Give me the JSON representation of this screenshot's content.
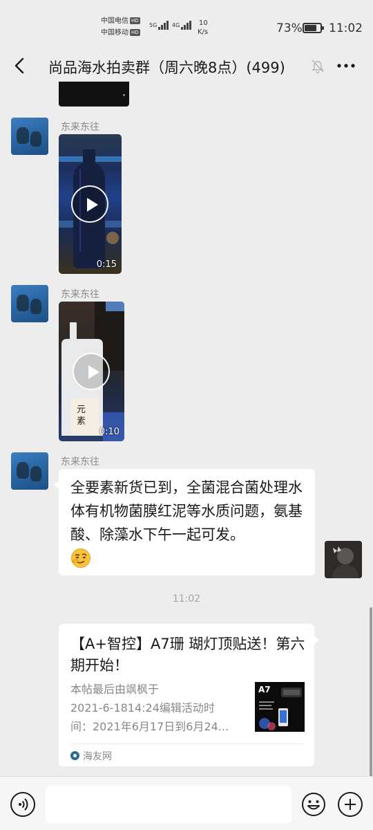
{
  "status_bar": {
    "carrier_1": "中国电信",
    "carrier_2": "中国移动",
    "hd_label": "HD",
    "net_5g": "5G",
    "net_4g": "4G",
    "speed_value": "10",
    "speed_unit": "K/s",
    "battery_percent": "73%",
    "time": "11:02"
  },
  "header": {
    "title": "尚品海水拍卖群（周六晚8点）(499)",
    "back_icon": "chevron-left-icon",
    "mute_icon": "bell-mute-icon",
    "more_icon": "ellipsis-icon"
  },
  "messages": [
    {
      "sender": "东来东往",
      "type": "video",
      "duration": "0:15"
    },
    {
      "sender": "东来东往",
      "type": "video",
      "duration": "0:10",
      "bottle_text": "元素"
    },
    {
      "sender": "东来东往",
      "type": "text",
      "text": "全要素新货已到，全菌混合菌处理水体有机物菌膜红泥等水质问题，氨基酸、除藻水下午一起可发。",
      "emoji": "smirk-emoji"
    }
  ],
  "time_separator": "11:02",
  "link_card": {
    "title": "【A+智控】A7珊 瑚灯顶贴送！第六期开始！",
    "desc_line_1": "本帖最后由飒枫于",
    "desc_line_2": "2021-6-1814:24编辑活动时",
    "desc_line_3": "间：2021年6月17日到6月24...",
    "thumb_label": "A7",
    "source": "海友网"
  },
  "input_bar": {
    "voice_icon": "voice-icon",
    "emoji_icon": "emoji-icon",
    "plus_icon": "plus-icon",
    "placeholder": ""
  },
  "colors": {
    "background": "#ededed",
    "bubble": "#ffffff",
    "meta_text": "#8a8a8a"
  }
}
